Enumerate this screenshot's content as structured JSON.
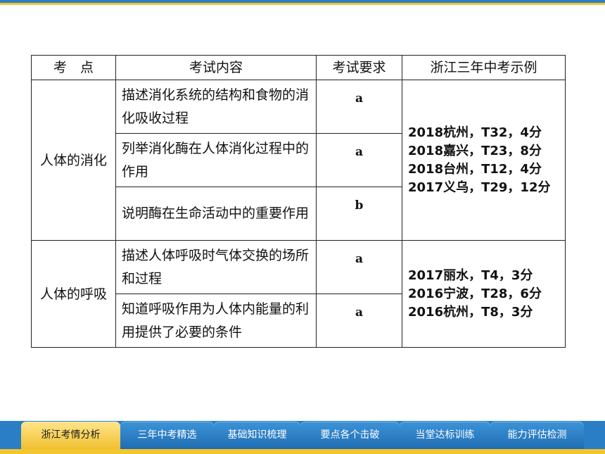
{
  "table": {
    "headers": [
      "考　点",
      "考试内容",
      "考试要求",
      "浙江三年中考示例"
    ],
    "groups": [
      {
        "topic": "人体的消化",
        "rows": [
          {
            "content": "描述消化系统的结构和食物的消化吸收过程",
            "requirement": "a"
          },
          {
            "content": "列举消化酶在人体消化过程中的作用",
            "requirement": "a"
          },
          {
            "content": "说明酶在生命活动中的重要作用",
            "requirement": "b"
          }
        ],
        "examples": [
          "2018杭州，T32，4分",
          "2018嘉兴，T23，8分",
          "2018台州，T12，4分",
          "2017义乌，T29，12分"
        ]
      },
      {
        "topic": "人体的呼吸",
        "rows": [
          {
            "content": "描述人体呼吸时气体交换的场所和过程",
            "requirement": "a"
          },
          {
            "content": "知道呼吸作用为人体内能量的利用提供了必要的条件",
            "requirement": "a"
          }
        ],
        "examples": [
          "2017丽水，T4，3分",
          "2016宁波，T28，6分",
          "2016杭州，T8，3分"
        ]
      }
    ]
  },
  "nav": {
    "tabs": [
      {
        "label": "浙江考情分析",
        "active": true
      },
      {
        "label": "三年中考精选",
        "active": false
      },
      {
        "label": "基础知识梳理",
        "active": false
      },
      {
        "label": "要点各个击破",
        "active": false
      },
      {
        "label": "当堂达标训练",
        "active": false
      },
      {
        "label": "能力评估检测",
        "active": false
      }
    ]
  },
  "colors": {
    "accent_blue": "#2a7ec6",
    "accent_yellow": "#f3c531",
    "border": "#222222"
  }
}
